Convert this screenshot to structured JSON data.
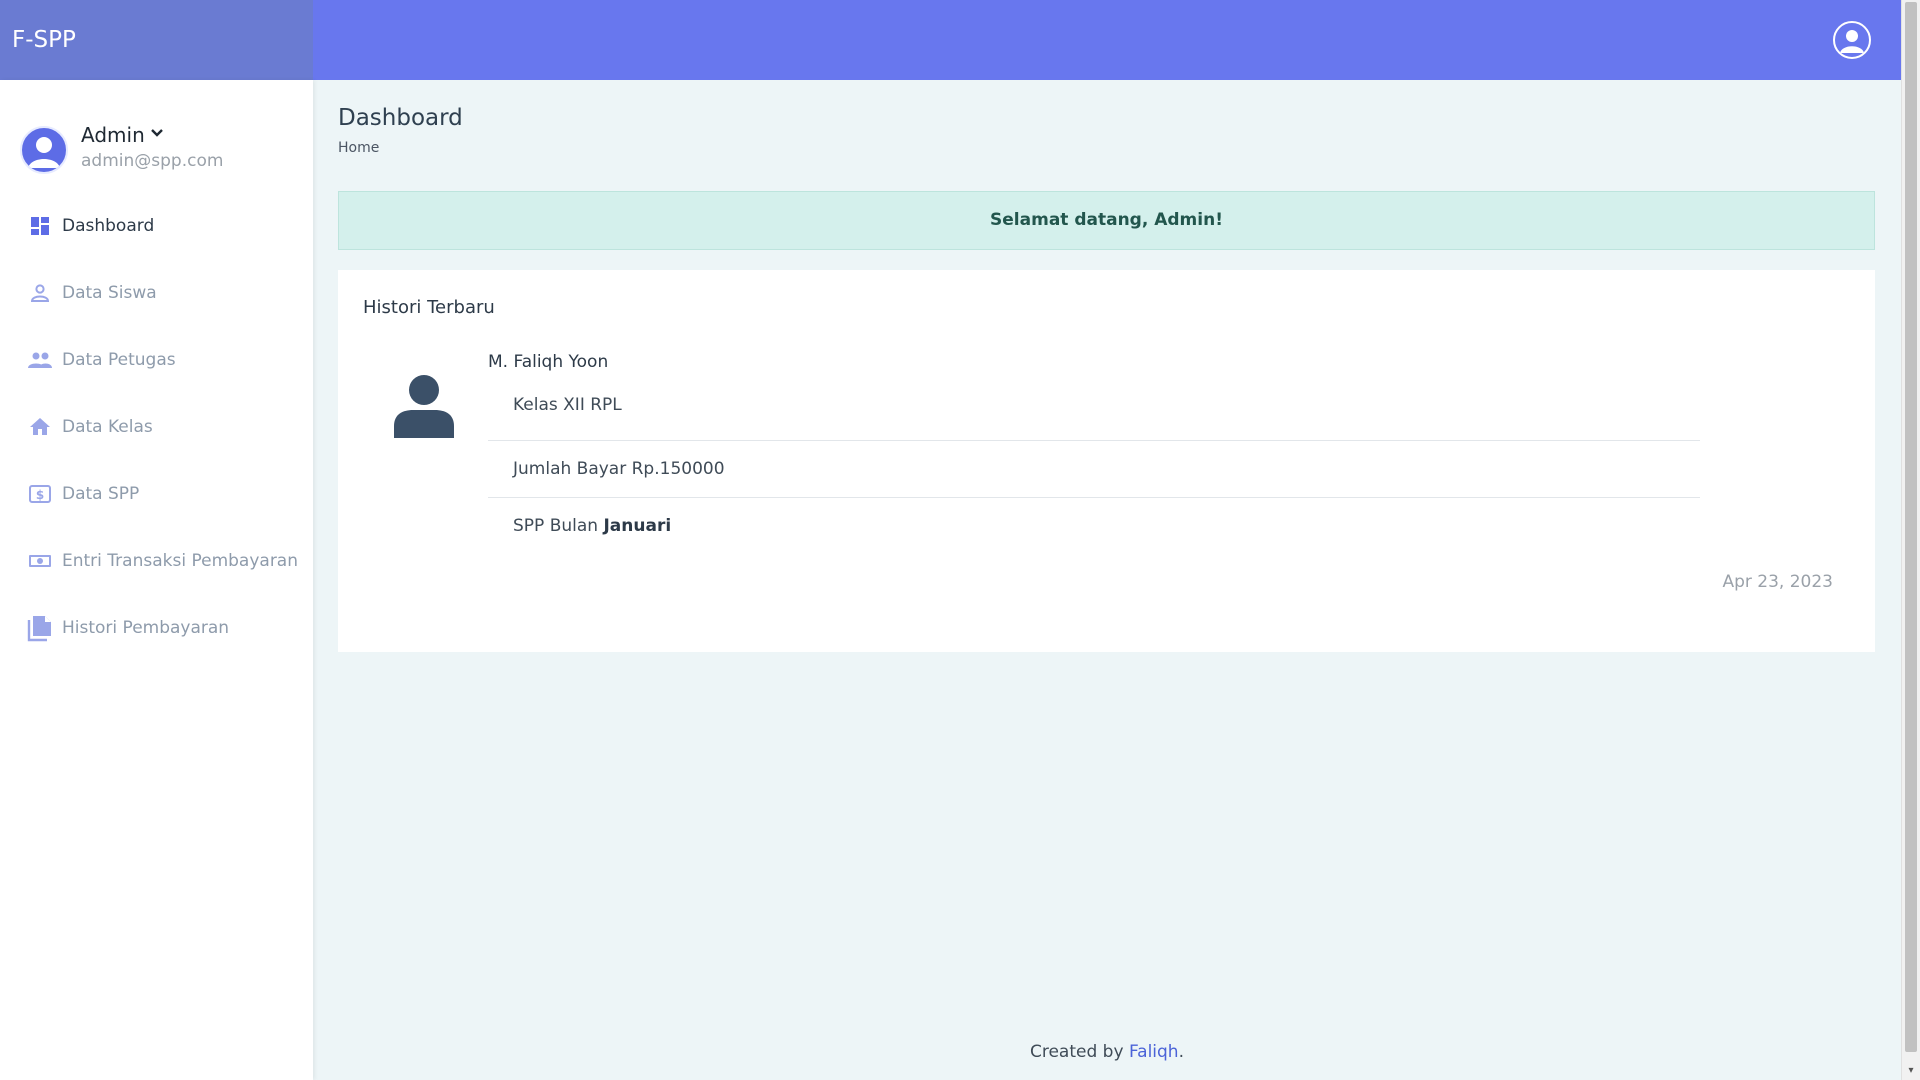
{
  "app": {
    "brand": "F-SPP"
  },
  "user": {
    "name": "Admin",
    "email": "admin@spp.com"
  },
  "sidebar": {
    "items": [
      {
        "label": "Dashboard",
        "icon": "dashboard-icon",
        "active": true
      },
      {
        "label": "Data Siswa",
        "icon": "person-icon"
      },
      {
        "label": "Data Petugas",
        "icon": "people-icon"
      },
      {
        "label": "Data Kelas",
        "icon": "home-icon"
      },
      {
        "label": "Data SPP",
        "icon": "dollar-icon"
      },
      {
        "label": "Entri Transaksi Pembayaran",
        "icon": "money-icon"
      },
      {
        "label": "Histori Pembayaran",
        "icon": "library-books-icon"
      }
    ]
  },
  "page": {
    "title": "Dashboard",
    "breadcrumb": "Home"
  },
  "alert": {
    "text": "Selamat datang, Admin!"
  },
  "history": {
    "title": "Histori Terbaru",
    "entry": {
      "name": "M. Faliqh Yoon",
      "class": "Kelas XII RPL",
      "amount": "Jumlah Bayar Rp.150000",
      "spp_prefix": "SPP Bulan",
      "spp_month": "Januari",
      "date": "Apr 23, 2023"
    }
  },
  "footer": {
    "prefix": "Created by",
    "author": "Faliqh",
    "suffix": "."
  },
  "colors": {
    "topbar": "#6877ee",
    "brand_bg": "#6a7bd2",
    "accent": "#5d6ce6",
    "alert_bg": "#d4f0ec"
  }
}
